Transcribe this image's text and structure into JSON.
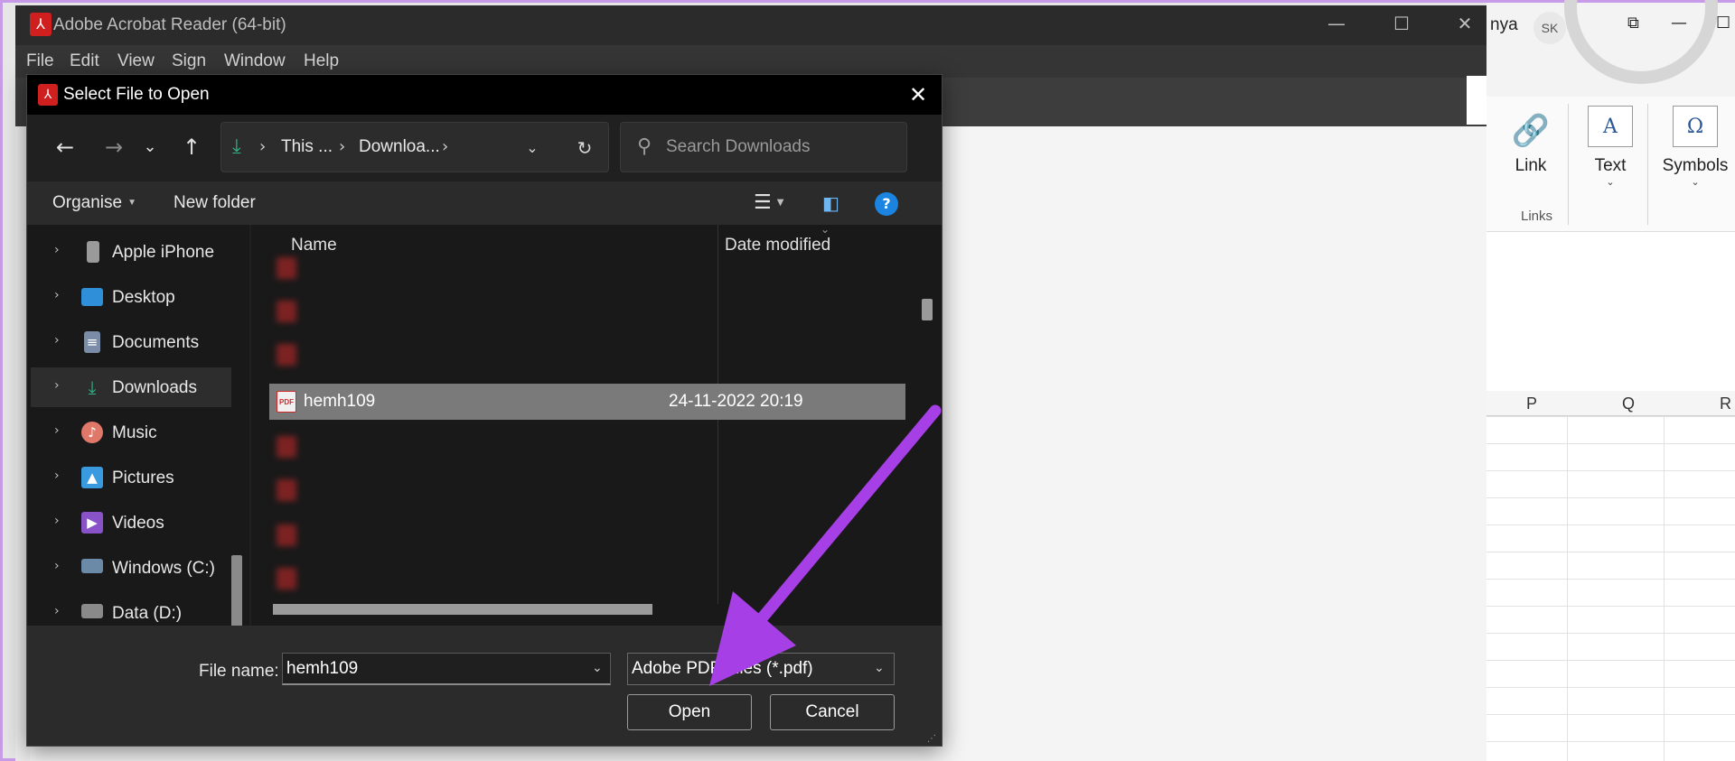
{
  "excel": {
    "user_partial": "nya",
    "avatar": "SK",
    "ribbon": {
      "link_label": "Link",
      "text_label": "Text",
      "symbols_label": "Symbols",
      "group_label": "Links"
    },
    "columns": [
      "P",
      "Q",
      "R"
    ]
  },
  "acrobat": {
    "window_title": "Adobe Acrobat Reader (64-bit)",
    "menu": [
      "File",
      "Edit",
      "View",
      "Sign",
      "Window",
      "Help"
    ]
  },
  "dialog": {
    "title": "Select File to Open",
    "address": {
      "segments": [
        "This ...",
        "Downloa..."
      ]
    },
    "search": {
      "placeholder": "Search Downloads"
    },
    "commands": {
      "organise": "Organise",
      "new_folder": "New folder"
    },
    "nav_items": [
      {
        "label": "Apple iPhone",
        "icon": "phone-icon"
      },
      {
        "label": "Desktop",
        "icon": "desktop-icon"
      },
      {
        "label": "Documents",
        "icon": "documents-icon"
      },
      {
        "label": "Downloads",
        "icon": "downloads-icon"
      },
      {
        "label": "Music",
        "icon": "music-icon"
      },
      {
        "label": "Pictures",
        "icon": "pictures-icon"
      },
      {
        "label": "Videos",
        "icon": "videos-icon"
      },
      {
        "label": "Windows (C:)",
        "icon": "drive-icon"
      },
      {
        "label": "Data (D:)",
        "icon": "drive-icon"
      }
    ],
    "columns": {
      "name": "Name",
      "date": "Date modified"
    },
    "files": [
      {
        "name": "hemh109",
        "date": "24-11-2022 20:19",
        "selected": true
      }
    ],
    "file_name_label": "File name:",
    "file_name_value": "hemh109",
    "file_type": "Adobe PDF Files (*.pdf)",
    "open_button": "Open",
    "cancel_button": "Cancel"
  },
  "colors": {
    "accent_arrow": "#a63fe6",
    "help_blue": "#1a84e0",
    "pdf_red": "#cf2a2a"
  }
}
